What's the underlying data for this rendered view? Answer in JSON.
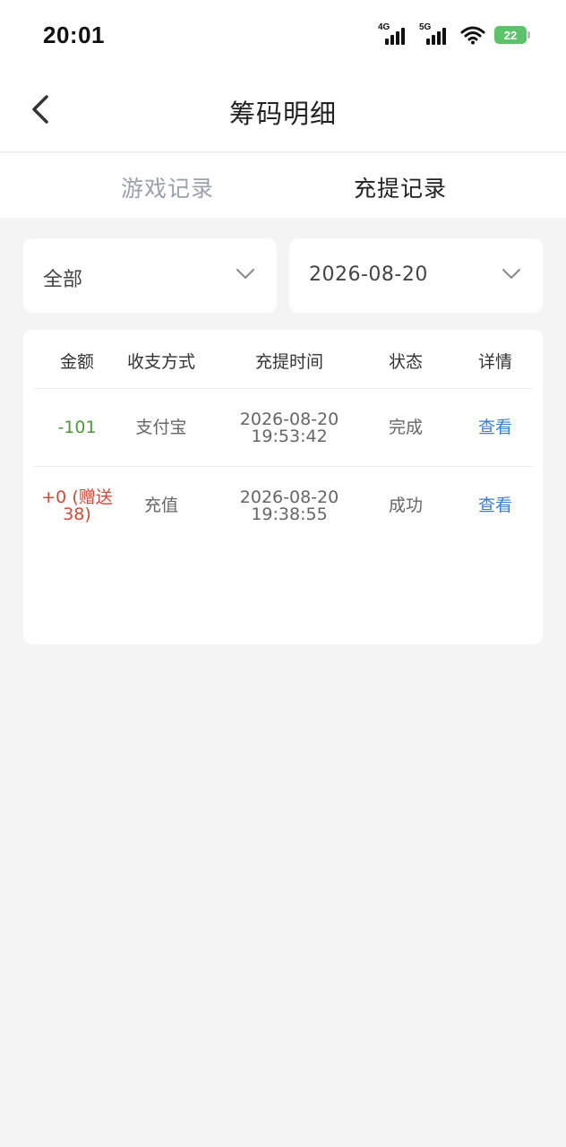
{
  "status": {
    "time": "20:01",
    "signal1": "4G",
    "signal2": "5G",
    "battery": "22"
  },
  "header": {
    "title": "筹码明细"
  },
  "tabs": [
    {
      "label": "游戏记录",
      "active": false
    },
    {
      "label": "充提记录",
      "active": true
    }
  ],
  "filters": {
    "type": "全部",
    "date": "2026-08-20"
  },
  "table": {
    "columns": [
      "金额",
      "收支方式",
      "充提时间",
      "状态",
      "详情"
    ],
    "rows": [
      {
        "amount": "-101",
        "method": "支付宝",
        "date": "2026-08-20",
        "time": "19:53:42",
        "status": "完成",
        "detail": "查看"
      },
      {
        "amount_line1": "+0 (赠送",
        "amount_line2": "38)",
        "method": "充值",
        "date": "2026-08-20",
        "time": "19:38:55",
        "status": "成功",
        "detail": "查看"
      }
    ]
  },
  "colors": {
    "negative": "#4a9a3a",
    "positive": "#d04a3a",
    "link": "#3a7fd0",
    "inactive_tab": "#9aa1ad"
  }
}
